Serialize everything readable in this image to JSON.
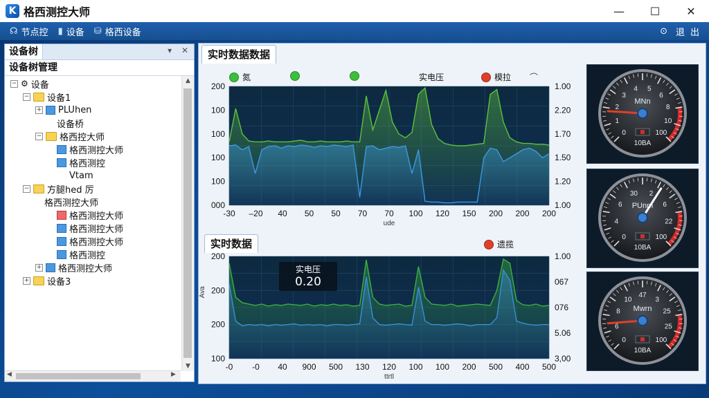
{
  "window": {
    "title": "格西测控大师",
    "icon_letter": "K",
    "controls": [
      "—",
      "☐",
      "✕"
    ]
  },
  "toolbar": {
    "items": [
      {
        "label": "节点控",
        "icon": "headset-icon"
      },
      {
        "label": "设备",
        "icon": "document-icon"
      },
      {
        "label": "格西设备",
        "icon": "database-icon"
      }
    ],
    "right_labels": [
      "退",
      "出"
    ]
  },
  "left_panel": {
    "tab_label": "设备树",
    "pin": "▾",
    "close": "✕",
    "header": "设备树管理",
    "tree": [
      {
        "label": "设备",
        "level": 0,
        "expander": "–",
        "icon": "gear"
      },
      {
        "label": "设备1",
        "level": 1,
        "expander": "–",
        "icon": "folder"
      },
      {
        "label": "PLUhen",
        "level": 2,
        "expander": "+",
        "icon": "device"
      },
      {
        "label": "设备桥",
        "level": 3,
        "expander": "",
        "icon": ""
      },
      {
        "label": "格西控大师",
        "level": 2,
        "expander": "–",
        "icon": "folder"
      },
      {
        "label": "格西测控大师",
        "level": 3,
        "expander": "",
        "icon": "device"
      },
      {
        "label": "格西测控",
        "level": 3,
        "expander": "",
        "icon": "device"
      },
      {
        "label": "Vtam",
        "level": 4,
        "expander": "",
        "icon": ""
      },
      {
        "label": "方腿hed 厉",
        "level": 1,
        "expander": "–",
        "icon": "folder"
      },
      {
        "label": "格西测控大师",
        "level": 2,
        "expander": "",
        "icon": ""
      },
      {
        "label": "格西测控大师",
        "level": 3,
        "expander": "",
        "icon": "device-red"
      },
      {
        "label": "格西测控大师",
        "level": 3,
        "expander": "",
        "icon": "device"
      },
      {
        "label": "格西测控大师",
        "level": 3,
        "expander": "",
        "icon": "device"
      },
      {
        "label": "格西测控",
        "level": 3,
        "expander": "",
        "icon": "device"
      },
      {
        "label": "格西测控大师",
        "level": 2,
        "expander": "+",
        "icon": "device"
      },
      {
        "label": "设备3",
        "level": 1,
        "expander": "+",
        "icon": "folder"
      }
    ]
  },
  "top_section": {
    "tab_label": "实时数据数据",
    "legend": [
      {
        "label": "氮",
        "color": "#3cbf3c"
      },
      {
        "label": "",
        "color": "#3cbf3c"
      },
      {
        "label": "",
        "color": "#3cbf3c"
      },
      {
        "label": "实电压",
        "color": ""
      },
      {
        "label": "模拉",
        "color": "#e0402a"
      },
      {
        "label": "⌒",
        "color": ""
      }
    ]
  },
  "bottom_section": {
    "tab_label": "实时数据",
    "legend": [
      {
        "label": "遗揽",
        "color": "#e0402a"
      }
    ],
    "readout": {
      "label": "实电压",
      "value": "0.20"
    }
  },
  "chart_data": [
    {
      "type": "line",
      "title": "",
      "x_ticks": [
        "-30",
        "–20",
        "40",
        "50",
        "50",
        "70",
        "70",
        "100",
        "120",
        "150",
        "200",
        "200",
        "200"
      ],
      "y_left_ticks": [
        "200",
        "100",
        "100",
        "100",
        "100",
        "000"
      ],
      "y_right_ticks": [
        "1.00",
        "2.20",
        "1.70",
        "1.50",
        "1.20",
        "1.00"
      ],
      "xlabel": "ude",
      "series": [
        {
          "color": "#5fc23c",
          "values": [
            0.3,
            0.72,
            0.4,
            0.31,
            0.3,
            0.3,
            0.31,
            0.3,
            0.3,
            0.3,
            0.31,
            0.32,
            0.3,
            0.3,
            0.31,
            0.3,
            0.3,
            0.3,
            0.31,
            0.3,
            0.3,
            0.88,
            0.45,
            0.7,
            0.95,
            0.55,
            0.4,
            0.35,
            0.42,
            0.9,
            0.98,
            0.52,
            0.34,
            0.28,
            0.26,
            0.25,
            0.25,
            0.26,
            0.27,
            0.28,
            0.9,
            0.96,
            0.55,
            0.35,
            0.3,
            0.28,
            0.28,
            0.27,
            0.27,
            0.26
          ]
        },
        {
          "color": "#3c9ae0",
          "values": [
            0.25,
            0.26,
            0.2,
            0.24,
            -0.1,
            0.2,
            0.24,
            0.25,
            0.22,
            0.25,
            0.24,
            0.26,
            0.25,
            0.23,
            0.25,
            0.24,
            0.26,
            0.25,
            0.24,
            0.26,
            -0.4,
            0.24,
            0.25,
            0.2,
            0.22,
            0.24,
            0.23,
            0.25,
            -0.1,
            0.2,
            -0.45,
            -0.46,
            -0.46,
            -0.47,
            -0.47,
            -0.46,
            -0.46,
            -0.46,
            -0.46,
            0.1,
            0.22,
            0.2,
            0.05,
            0.1,
            0.15,
            0.2,
            0.22,
            0.18,
            0.1,
            0.15
          ]
        }
      ]
    },
    {
      "type": "line",
      "title": "",
      "x_ticks": [
        "-0",
        "-0",
        "40",
        "900",
        "500",
        "130",
        "120",
        "100",
        "100",
        "200",
        "500",
        "400",
        "500"
      ],
      "y_left_ticks": [
        "200",
        "200",
        "200",
        "100"
      ],
      "y_left_label": "Ava",
      "y_right_ticks": [
        "1.00",
        "067",
        "076",
        "5.06",
        "3,00"
      ],
      "xlabel": "ttrtl",
      "series": [
        {
          "color": "#3cb043",
          "values": [
            0.9,
            0.4,
            0.32,
            0.3,
            0.28,
            0.3,
            0.27,
            0.29,
            0.28,
            0.3,
            0.29,
            0.28,
            0.3,
            0.27,
            0.29,
            0.28,
            0.3,
            0.28,
            0.29,
            0.27,
            0.28,
            0.95,
            0.4,
            0.3,
            0.28,
            0.29,
            0.3,
            0.27,
            0.28,
            0.85,
            0.4,
            0.3,
            0.29,
            0.28,
            0.3,
            0.27,
            0.28,
            0.29,
            0.3,
            0.29,
            0.28,
            0.5,
            0.96,
            0.9,
            0.35,
            0.29,
            0.28,
            0.3,
            0.27,
            0.28
          ]
        },
        {
          "color": "#3a8fd6",
          "values": [
            0.6,
            0.05,
            -0.02,
            0.0,
            -0.01,
            0.0,
            -0.02,
            0.0,
            -0.01,
            0.0,
            0.01,
            -0.01,
            0.0,
            -0.01,
            0.0,
            -0.02,
            0.0,
            0.0,
            -0.01,
            0.0,
            0.01,
            0.7,
            0.1,
            0.0,
            -0.01,
            0.0,
            0.01,
            0.0,
            -0.01,
            0.55,
            0.05,
            0.0,
            0.0,
            -0.01,
            0.0,
            0.01,
            0.0,
            -0.02,
            0.0,
            0.0,
            0.0,
            0.1,
            0.8,
            0.65,
            0.05,
            0.02,
            0.0,
            -0.01,
            0.0,
            0.0
          ]
        }
      ]
    }
  ],
  "gauges": [
    {
      "label": "MNn",
      "unit": "10BA",
      "ticks": [
        "0",
        "1",
        "2",
        "3",
        "4",
        "5",
        "6",
        "8",
        "10",
        "100"
      ],
      "value_fraction": 0.18,
      "needle_color": "#e0402a"
    },
    {
      "label": "PUnm",
      "unit": "10BA",
      "ticks": [
        "0",
        "4",
        "6",
        "30",
        "2",
        "6",
        "22",
        "100"
      ],
      "value_fraction": 0.62,
      "needle_color": "#ffffff"
    },
    {
      "label": "Mwrn",
      "unit": "10BA",
      "ticks": [
        "0",
        "6",
        "8",
        "10",
        "47",
        "3",
        "25",
        "25",
        "100"
      ],
      "value_fraction": 0.15,
      "needle_color": "#e0402a"
    }
  ],
  "colors": {
    "accent": "#1f5fae",
    "chart_bg": "#0e2540",
    "gauge_red": "#d02a2a"
  }
}
